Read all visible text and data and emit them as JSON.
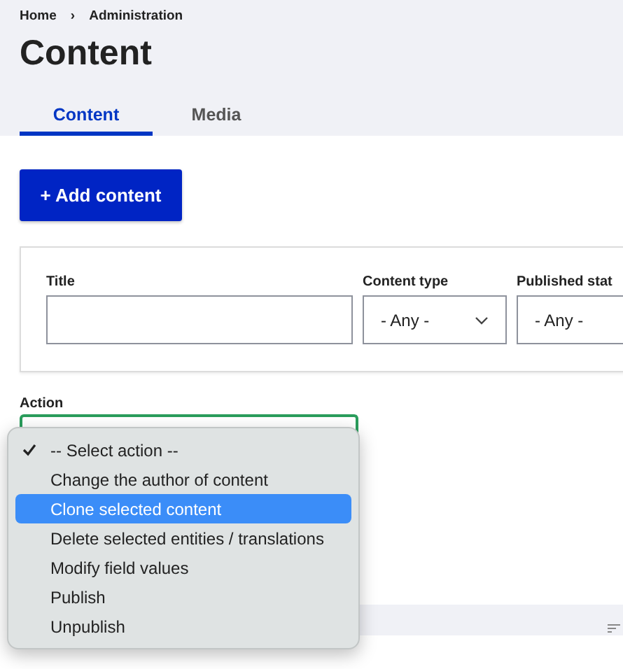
{
  "breadcrumb": [
    {
      "label": "Home"
    },
    {
      "label": "Administration"
    }
  ],
  "breadcrumb_separator": "›",
  "title": "Content",
  "tabs": [
    {
      "label": "Content",
      "selected": true
    },
    {
      "label": "Media",
      "selected": false
    }
  ],
  "add_button": "+ Add content",
  "filters": [
    {
      "label": "Title",
      "kind": "text"
    },
    {
      "label": "Content type",
      "kind": "select",
      "value": "- Any -"
    },
    {
      "label": "Published stat",
      "kind": "select_cut",
      "value": "- Any -"
    }
  ],
  "action": {
    "label": "Action",
    "menu": [
      {
        "label": "-- Select action --",
        "checked": true,
        "selected": false
      },
      {
        "label": "Change the author of content",
        "checked": false,
        "selected": false
      },
      {
        "label": "Clone selected content",
        "checked": false,
        "selected": true
      },
      {
        "label": "Delete selected entities / translations",
        "checked": false,
        "selected": false
      },
      {
        "label": "Modify field values",
        "checked": false,
        "selected": false
      },
      {
        "label": "Publish",
        "checked": false,
        "selected": false
      },
      {
        "label": "Unpublish",
        "checked": false,
        "selected": false
      }
    ]
  }
}
